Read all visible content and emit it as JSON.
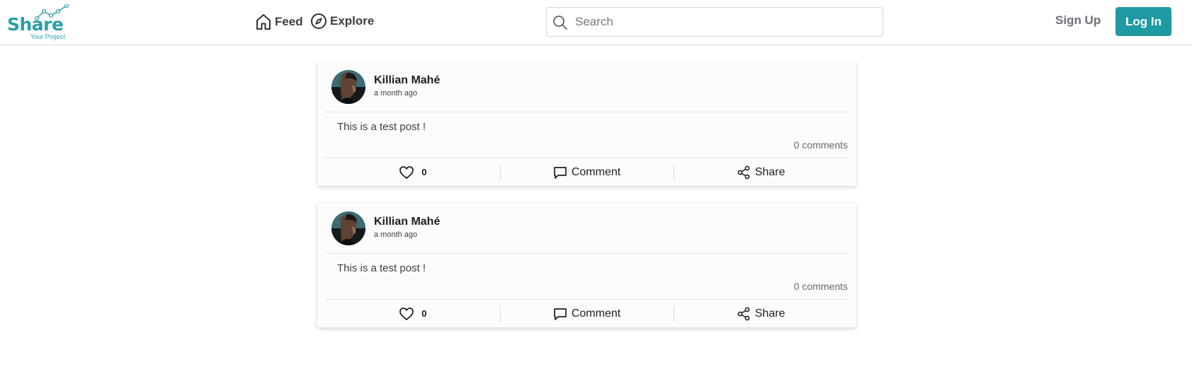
{
  "brand": {
    "name": "Share",
    "tagline": "Your Project",
    "color": "#2a9fa6"
  },
  "nav": {
    "feed": {
      "label": "Feed",
      "icon": "home-icon"
    },
    "explore": {
      "label": "Explore",
      "icon": "compass-icon"
    }
  },
  "search": {
    "placeholder": "Search",
    "value": "",
    "icon": "search-icon"
  },
  "auth": {
    "signup_label": "Sign Up",
    "login_label": "Log In",
    "accent": "#1f9aa3"
  },
  "posts": [
    {
      "author": "Killian Mahé",
      "time": "a month ago",
      "content": "This is a test post !",
      "comments": "0 comments",
      "likes": "0",
      "comment_label": "Comment",
      "share_label": "Share"
    },
    {
      "author": "Killian Mahé",
      "time": "a month ago",
      "content": "This is a test post !",
      "comments": "0 comments",
      "likes": "0",
      "comment_label": "Comment",
      "share_label": "Share"
    }
  ]
}
